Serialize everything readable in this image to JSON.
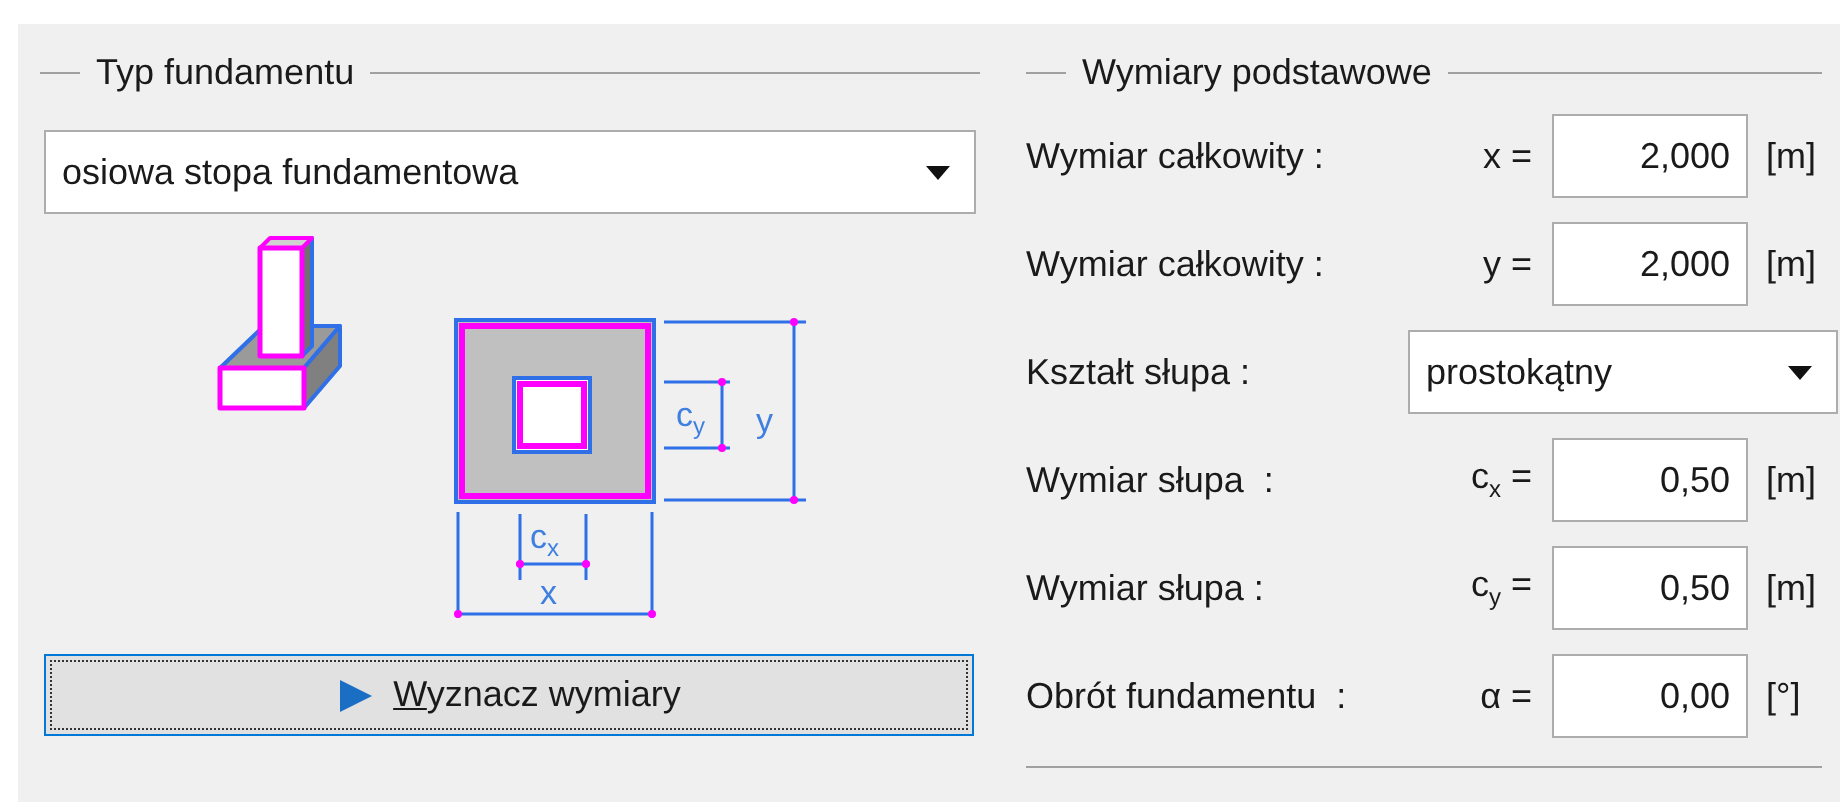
{
  "left_group": {
    "title": "Typ fundamentu",
    "foundation_type": {
      "value": "osiowa stopa fundamentowa"
    },
    "diagram": {
      "labels": [
        {
          "base": "c",
          "sub": "y"
        },
        {
          "base": "y"
        },
        {
          "base": "c",
          "sub": "x"
        },
        {
          "base": "x"
        }
      ]
    },
    "button": {
      "label": "Wyznacz wymiary",
      "focused": true
    }
  },
  "right_group": {
    "title": "Wymiary podstawowe",
    "rows": [
      {
        "kind": "input",
        "label": "Wymiar całkowity :",
        "symbol": "x =",
        "value": "2,000",
        "unit": "[m]"
      },
      {
        "kind": "input",
        "label": "Wymiar całkowity :",
        "symbol": "y =",
        "value": "2,000",
        "unit": "[m]"
      },
      {
        "kind": "select",
        "label": "Kształt słupa :",
        "value": "prostokątny"
      },
      {
        "kind": "input",
        "label": "Wymiar słupa  :",
        "symbol": "c$_{x}$ =",
        "value": "0,50",
        "unit": "[m]"
      },
      {
        "kind": "input",
        "label": "Wymiar słupa :",
        "symbol": "c$_{y}$ =",
        "value": "0,50",
        "unit": "[m]"
      },
      {
        "kind": "input",
        "label": "Obrót fundamentu  :",
        "symbol": "α =",
        "value": "0,00",
        "unit": "[°]"
      }
    ]
  }
}
